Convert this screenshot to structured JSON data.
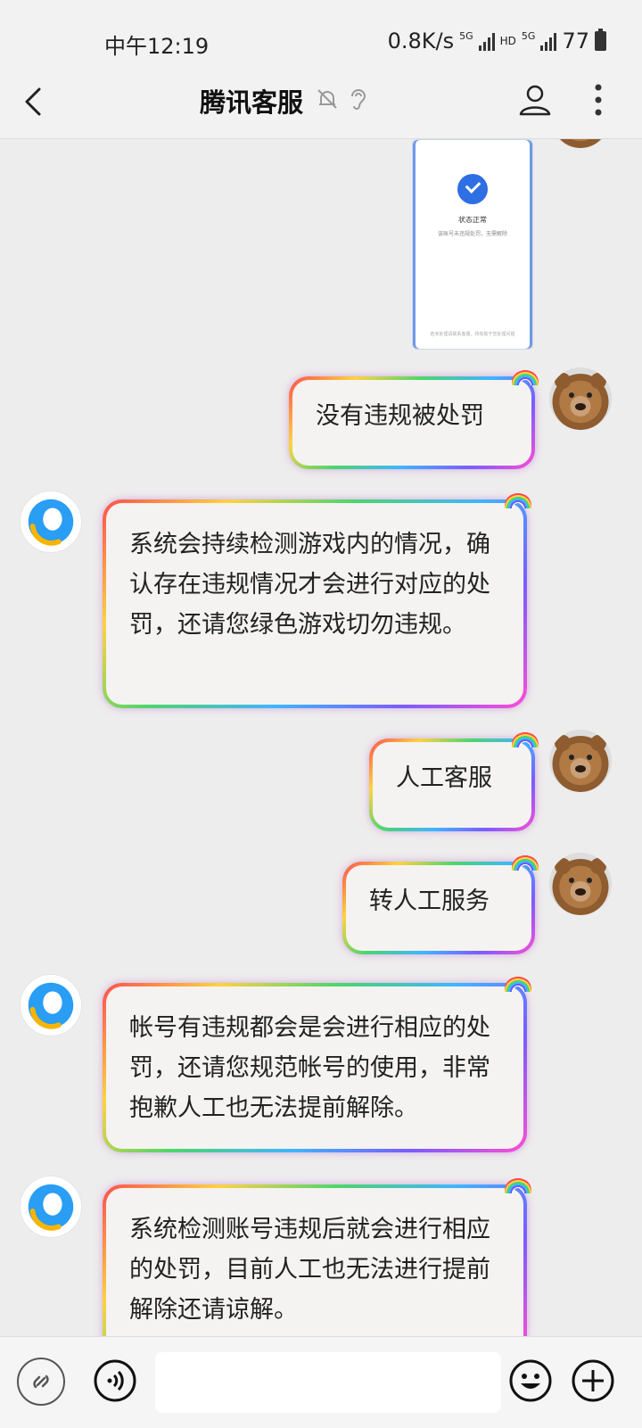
{
  "status_bar": {
    "time": "中午12:19",
    "net_speed": "0.8K/s",
    "sim1": "5G",
    "hd": "HD",
    "sim2": "5G",
    "battery": "77"
  },
  "header": {
    "title": "腾讯客服",
    "icons": [
      "back-arrow-icon",
      "mute-bell-icon",
      "ear-icon",
      "person-icon",
      "more-vertical-icon"
    ]
  },
  "shared_image": {
    "title": "状态正常",
    "subtitle": "该账号未违规处罚，无需解除",
    "footer": "若未处理请联系客服，将有助于您处理问题"
  },
  "messages": [
    {
      "from": "user",
      "text": "没有违规被处罚"
    },
    {
      "from": "service",
      "text": "系统会持续检测游戏内的情况，确认存在违规情况才会进行对应的处罚，还请您绿色游戏切勿违规。"
    },
    {
      "from": "user",
      "text": "人工客服"
    },
    {
      "from": "user",
      "text": "转人工服务"
    },
    {
      "from": "service",
      "text": "帐号有违规都会是会进行相应的处罚，还请您规范帐号的使用，非常抱歉人工也无法提前解除。"
    },
    {
      "from": "service",
      "text": "系统检测账号违规后就会进行相应的处罚，目前人工也无法进行提前解除还请谅解。"
    }
  ],
  "input_bar": {
    "placeholder": "",
    "icons": [
      "mini-app-link-icon",
      "voice-icon",
      "emoji-icon",
      "plus-icon"
    ]
  }
}
